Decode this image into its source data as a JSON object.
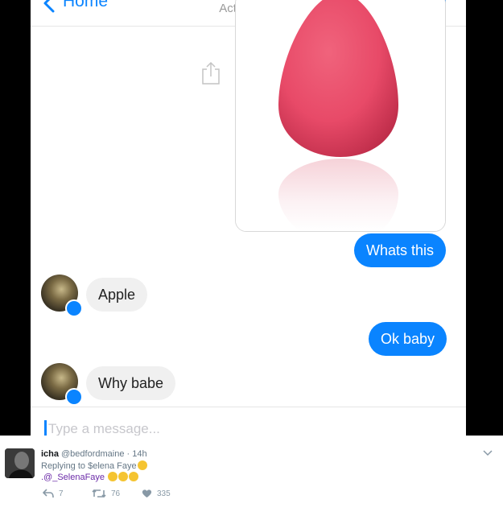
{
  "messenger": {
    "back_label": "Home",
    "status": "Active now",
    "composer_placeholder": "Type a message...",
    "messages": [
      {
        "from": "me",
        "text": "Whats this"
      },
      {
        "from": "them",
        "text": "Apple"
      },
      {
        "from": "me",
        "text": "Ok baby"
      },
      {
        "from": "them",
        "text": "Why babe"
      }
    ]
  },
  "tweet": {
    "name": "icha",
    "handle_time": "@bedfordmaine · 14h",
    "replying_to": "Replying to $elena Faye",
    "mention": ".@_SelenaFaye",
    "reply_count": "7",
    "retweet_count": "76",
    "like_count": "335"
  },
  "colors": {
    "accent": "#0a84ff",
    "incoming_bubble": "#f0f0f0",
    "sponge": "#e84a68",
    "mention": "#6b2ba8"
  }
}
